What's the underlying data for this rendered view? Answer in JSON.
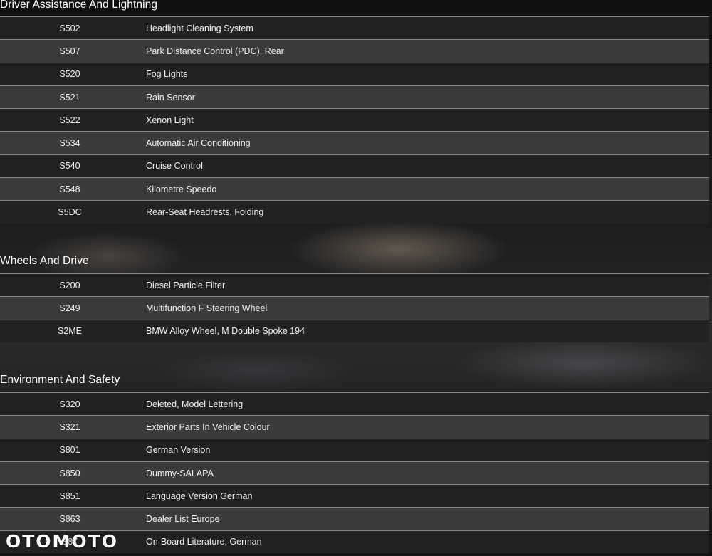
{
  "sections": [
    {
      "title": "Driver Assistance And Lightning",
      "rows": [
        {
          "code": "S502",
          "desc": "Headlight Cleaning System"
        },
        {
          "code": "S507",
          "desc": "Park Distance Control (PDC), Rear"
        },
        {
          "code": "S520",
          "desc": "Fog Lights"
        },
        {
          "code": "S521",
          "desc": "Rain Sensor"
        },
        {
          "code": "S522",
          "desc": "Xenon Light"
        },
        {
          "code": "S534",
          "desc": "Automatic Air Conditioning"
        },
        {
          "code": "S540",
          "desc": "Cruise Control"
        },
        {
          "code": "S548",
          "desc": "Kilometre Speedo"
        },
        {
          "code": "S5DC",
          "desc": "Rear-Seat Headrests, Folding"
        }
      ]
    },
    {
      "title": "Wheels And Drive",
      "rows": [
        {
          "code": "S200",
          "desc": "Diesel Particle Filter"
        },
        {
          "code": "S249",
          "desc": "Multifunction F Steering Wheel"
        },
        {
          "code": "S2ME",
          "desc": "BMW Alloy Wheel, M Double Spoke 194"
        }
      ]
    },
    {
      "title": "Environment And Safety",
      "rows": [
        {
          "code": "S320",
          "desc": "Deleted, Model Lettering"
        },
        {
          "code": "S321",
          "desc": "Exterior Parts In Vehicle Colour"
        },
        {
          "code": "S801",
          "desc": "German Version"
        },
        {
          "code": "S850",
          "desc": "Dummy-SALAPA"
        },
        {
          "code": "S851",
          "desc": "Language Version German"
        },
        {
          "code": "S863",
          "desc": "Dealer List Europe"
        },
        {
          "code": "S87",
          "desc": "On-Board Literature, German"
        }
      ]
    }
  ],
  "watermark": "OTOMOTO"
}
